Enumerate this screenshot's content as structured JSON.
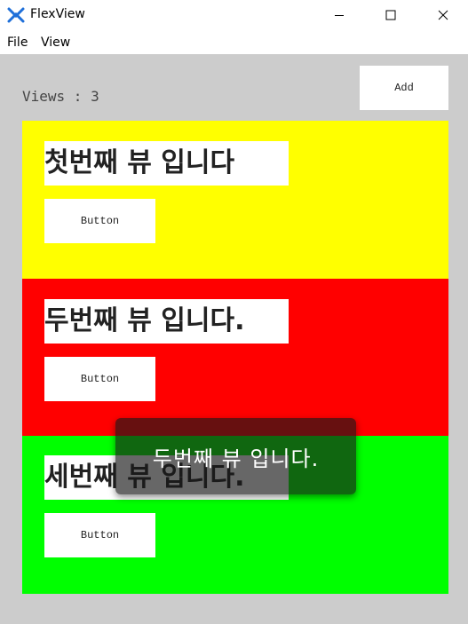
{
  "window": {
    "title": "FlexView",
    "icon": "flexview-app-icon",
    "controls": [
      "minimize-icon",
      "maximize-icon",
      "close-icon"
    ]
  },
  "menu": {
    "file": "File",
    "view": "View"
  },
  "toolbar": {
    "views_label": "Views : 3",
    "add_label": "Add"
  },
  "views": [
    {
      "title": "첫번째 뷰 입니다",
      "button_label": "Button",
      "color": "#ffff00"
    },
    {
      "title": "두번째 뷰 입니다.",
      "button_label": "Button",
      "color": "#ff0000"
    },
    {
      "title": "세번째 뷰 입니다.",
      "button_label": "Button",
      "color": "#00ff00"
    }
  ],
  "toast": {
    "message": "두번째 뷰 입니다."
  },
  "colors": {
    "background": "#cccccc",
    "panel_white": "#ffffff"
  }
}
